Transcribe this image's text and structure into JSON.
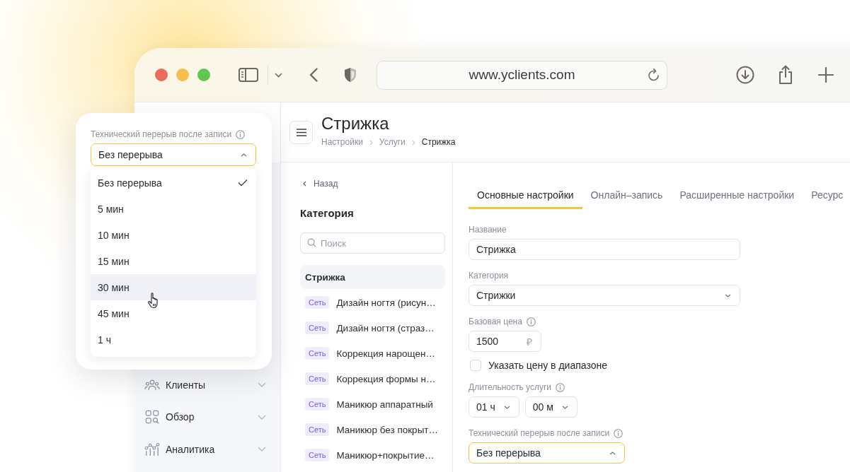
{
  "browser": {
    "url": "www.yclients.com"
  },
  "sidebar": {
    "items": [
      {
        "label": "Клиенты"
      },
      {
        "label": "Обзор"
      },
      {
        "label": "Аналитика"
      }
    ]
  },
  "header": {
    "title": "Стрижка",
    "breadcrumbs": [
      {
        "label": "Настройки",
        "current": false
      },
      {
        "label": "Услуги",
        "current": false
      },
      {
        "label": "Стрижка",
        "current": true
      }
    ]
  },
  "category_panel": {
    "back_link": "Назад",
    "title": "Категория",
    "search": {
      "placeholder": "Поиск"
    },
    "items": [
      {
        "name": "Стрижка",
        "selected": true
      },
      {
        "badge": "Сеть",
        "name": "Дизайн ногтя (рисун…",
        "selected": false
      },
      {
        "badge": "Сеть",
        "name": "Дизайн ногтя (страз…",
        "selected": false
      },
      {
        "badge": "Сеть",
        "name": "Коррекция нарощен…",
        "selected": false
      },
      {
        "badge": "Сеть",
        "name": "Коррекция формы н…",
        "selected": false
      },
      {
        "badge": "Сеть",
        "name": "Маникюр аппаратный",
        "selected": false
      },
      {
        "badge": "Сеть",
        "name": "Маникюр без покрыт…",
        "selected": false
      },
      {
        "badge": "Сеть",
        "name": "Маникюр+покрытие…",
        "selected": false
      }
    ]
  },
  "tabs": [
    {
      "label": "Основные настройки",
      "selected": true
    },
    {
      "label": "Онлайн–запись",
      "selected": false
    },
    {
      "label": "Расширенные настройки",
      "selected": false
    },
    {
      "label": "Ресурс",
      "selected": false
    }
  ],
  "form": {
    "fields": [
      {
        "kind": "text",
        "label": "Название",
        "value": "Стрижка"
      },
      {
        "kind": "select",
        "label": "Категория",
        "value": "Стрижки",
        "open": false
      },
      {
        "kind": "price",
        "label": "Базовая цена",
        "info": true,
        "value": "1500",
        "currency": "₽"
      },
      {
        "kind": "checkbox",
        "label": "Указать цену в диапазоне",
        "checked": false
      },
      {
        "kind": "duration",
        "label": "Длительность услуги",
        "info": true,
        "parts": [
          {
            "value": "01 ч"
          },
          {
            "value": "00 м"
          }
        ]
      },
      {
        "kind": "select",
        "label": "Технический перерыв после записи",
        "info": true,
        "value": "Без перерыва",
        "open": true
      }
    ]
  },
  "popup": {
    "label": "Технический перерыв после записи",
    "info": true,
    "value": "Без перерыва",
    "open": true,
    "options": [
      {
        "label": "Без перерыва",
        "selected": true,
        "hovered": false
      },
      {
        "label": "5 мин",
        "selected": false,
        "hovered": false
      },
      {
        "label": "10 мин",
        "selected": false,
        "hovered": false
      },
      {
        "label": "15 мин",
        "selected": false,
        "hovered": false
      },
      {
        "label": "30 мин",
        "selected": false,
        "hovered": true
      },
      {
        "label": "45 мин",
        "selected": false,
        "hovered": false
      },
      {
        "label": "1 ч",
        "selected": false,
        "hovered": false
      }
    ]
  }
}
